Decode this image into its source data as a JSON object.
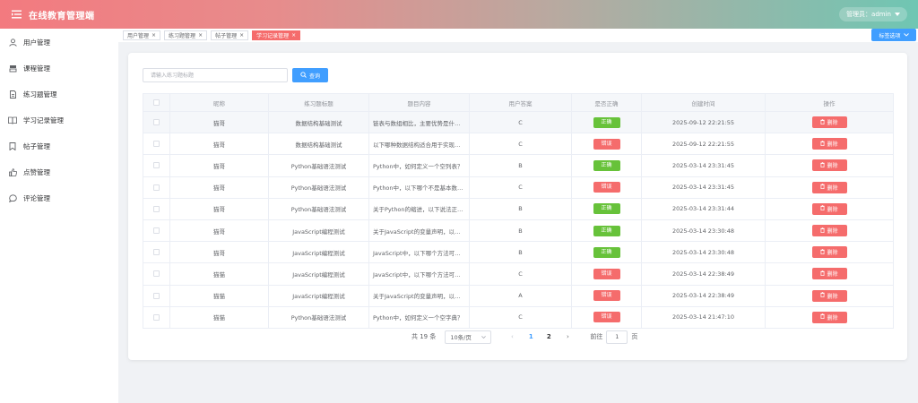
{
  "header": {
    "title": "在线教育管理端",
    "user_label": "管理员：admin"
  },
  "sidebar": {
    "items": [
      {
        "label": "用户管理",
        "icon": "user-icon"
      },
      {
        "label": "课程管理",
        "icon": "course-icon"
      },
      {
        "label": "练习题管理",
        "icon": "document-icon"
      },
      {
        "label": "学习记录管理",
        "icon": "book-icon"
      },
      {
        "label": "帖子管理",
        "icon": "bookmark-icon"
      },
      {
        "label": "点赞管理",
        "icon": "thumb-up-icon"
      },
      {
        "label": "评论管理",
        "icon": "comment-icon"
      }
    ]
  },
  "tabs": [
    {
      "label": "用户管理",
      "active": false
    },
    {
      "label": "练习题管理",
      "active": false
    },
    {
      "label": "帖子管理",
      "active": false
    },
    {
      "label": "学习记录管理",
      "active": true
    }
  ],
  "tab_menu_label": "标签选项",
  "search": {
    "placeholder": "请输入练习题标题",
    "button_label": "查询"
  },
  "table": {
    "headers": [
      "昵称",
      "练习题标题",
      "题目内容",
      "用户答案",
      "是否正确",
      "创建时间",
      "操作"
    ],
    "delete_label": "删除",
    "rows": [
      {
        "nickname": "猫哥",
        "title": "数据结构基础测试",
        "content": "链表与数组相比，主要优势是什么？",
        "answer": "C",
        "correct": "正确",
        "is_correct": true,
        "time": "2025-09-12 22:21:55"
      },
      {
        "nickname": "猫哥",
        "title": "数据结构基础测试",
        "content": "以下哪种数据结构适合用于实现队列？",
        "answer": "C",
        "correct": "错误",
        "is_correct": false,
        "time": "2025-09-12 22:21:55"
      },
      {
        "nickname": "猫哥",
        "title": "Python基础语法测试",
        "content": "Python中，如何定义一个空列表？",
        "answer": "B",
        "correct": "正确",
        "is_correct": true,
        "time": "2025-03-14 23:31:45"
      },
      {
        "nickname": "猫哥",
        "title": "Python基础语法测试",
        "content": "Python中，以下哪个不是基本数据类型？",
        "answer": "C",
        "correct": "错误",
        "is_correct": false,
        "time": "2025-03-14 23:31:45"
      },
      {
        "nickname": "猫哥",
        "title": "Python基础语法测试",
        "content": "关于Python的缩进，以下说法正确的是？",
        "answer": "B",
        "correct": "正确",
        "is_correct": true,
        "time": "2025-03-14 23:31:44"
      },
      {
        "nickname": "猫哥",
        "title": "JavaScript编程测试",
        "content": "关于JavaScript的变量声明，以下说法正确的是？",
        "answer": "B",
        "correct": "正确",
        "is_correct": true,
        "time": "2025-03-14 23:30:48"
      },
      {
        "nickname": "猫哥",
        "title": "JavaScript编程测试",
        "content": "JavaScript中，以下哪个方法可以添加数组元素？",
        "answer": "B",
        "correct": "正确",
        "is_correct": true,
        "time": "2025-03-14 23:30:48"
      },
      {
        "nickname": "猫猫",
        "title": "JavaScript编程测试",
        "content": "JavaScript中，以下哪个方法可以删除数组元素？",
        "answer": "C",
        "correct": "错误",
        "is_correct": false,
        "time": "2025-03-14 22:38:49"
      },
      {
        "nickname": "猫猫",
        "title": "JavaScript编程测试",
        "content": "关于JavaScript的变量声明，以下说法正确的是？",
        "answer": "A",
        "correct": "错误",
        "is_correct": false,
        "time": "2025-03-14 22:38:49"
      },
      {
        "nickname": "猫猫",
        "title": "Python基础语法测试",
        "content": "Python中，如何定义一个空字典？",
        "answer": "C",
        "correct": "错误",
        "is_correct": false,
        "time": "2025-03-14 21:47:10"
      }
    ]
  },
  "pagination": {
    "total_label": "共 19 条",
    "page_size_label": "10条/页",
    "pages": [
      "1",
      "2"
    ],
    "current_page": "1",
    "goto_label": "前往",
    "goto_value": "1",
    "page_suffix": "页"
  },
  "colors": {
    "accent": "#409eff",
    "danger": "#f56c6c",
    "success": "#67c23a"
  }
}
